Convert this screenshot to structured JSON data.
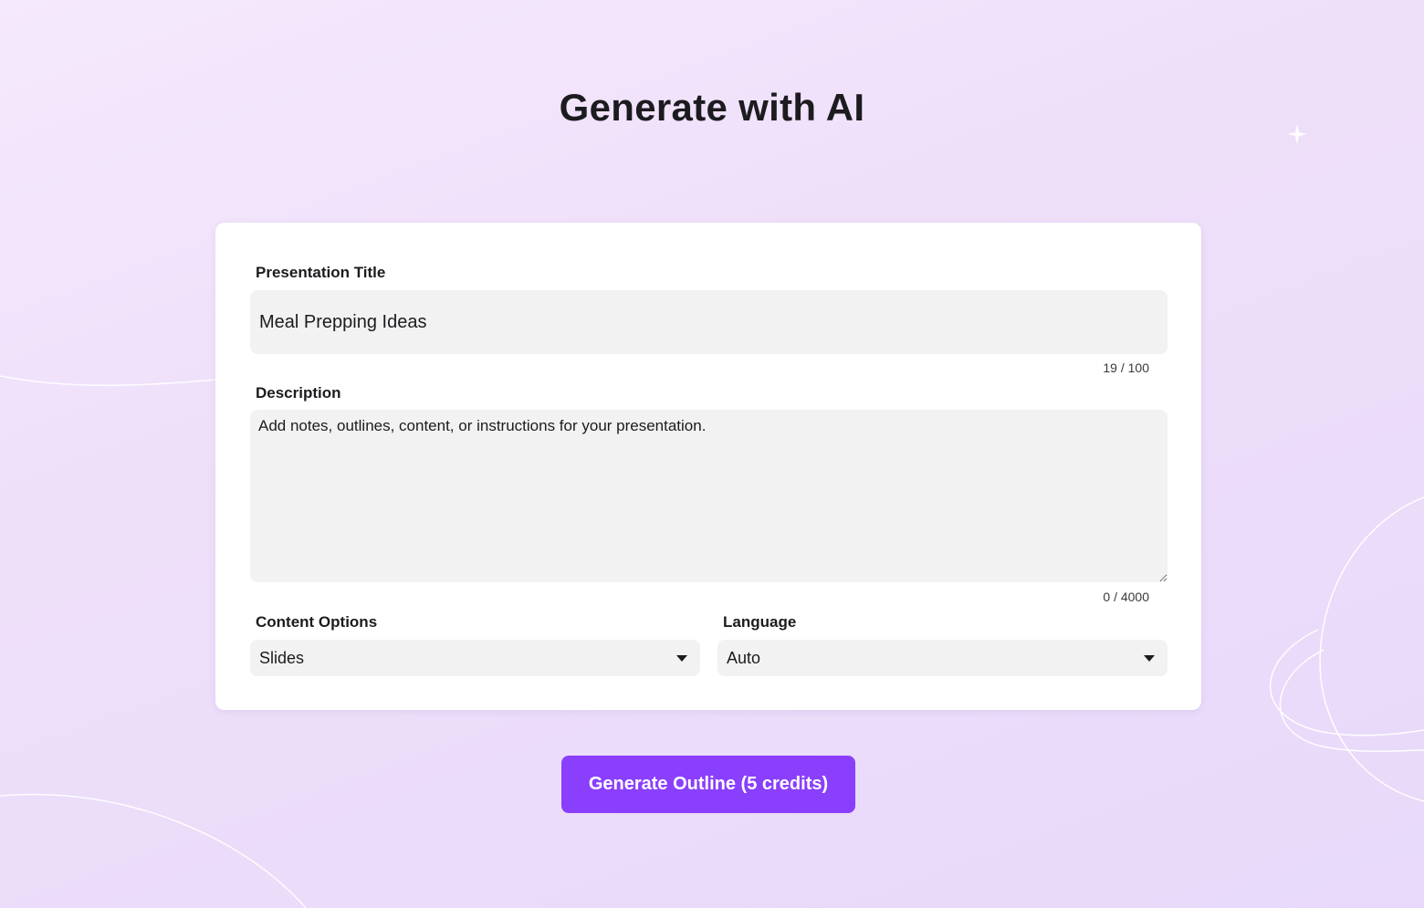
{
  "page": {
    "title": "Generate with AI"
  },
  "form": {
    "title_field": {
      "label": "Presentation Title",
      "value": "Meal Prepping Ideas",
      "counter": "19 / 100"
    },
    "description_field": {
      "label": "Description",
      "value": "",
      "placeholder": "Add notes, outlines, content, or instructions for your presentation.",
      "counter": "0 / 4000"
    },
    "content_options": {
      "label": "Content Options",
      "selected": "Slides"
    },
    "language": {
      "label": "Language",
      "selected": "Auto"
    }
  },
  "actions": {
    "generate_label": "Generate Outline (5 credits)"
  },
  "colors": {
    "accent": "#8a3ffc",
    "background": "#eedff9",
    "card": "#ffffff",
    "field": "#f2f2f2"
  },
  "icons": {
    "select_caret": "chevron-down-icon",
    "sparkle": "sparkle-icon"
  }
}
